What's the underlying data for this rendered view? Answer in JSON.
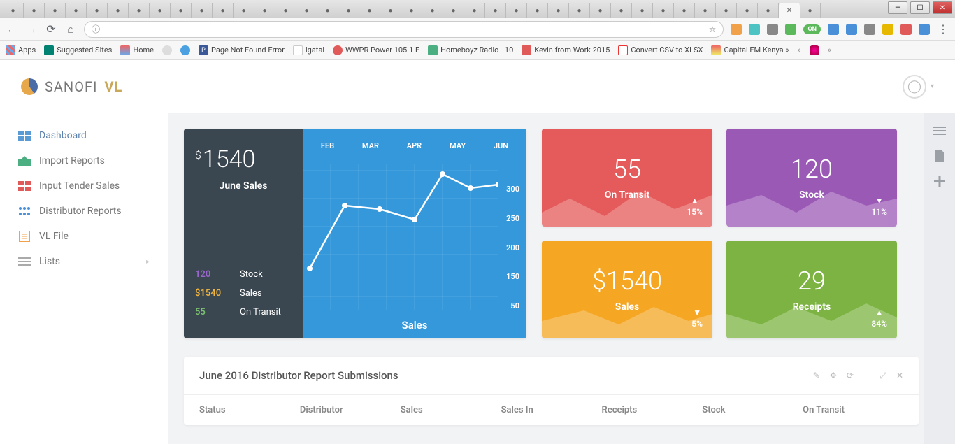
{
  "browser": {
    "window_controls": {
      "min": "—",
      "max": "☐",
      "close": "✕"
    },
    "nav": {
      "back": "←",
      "forward": "→",
      "reload": "⟳",
      "home": "⌂",
      "info": "ⓘ",
      "star": "☆"
    },
    "ext_toggle": "ON",
    "bookmarks": {
      "apps": "Apps",
      "suggested": "Suggested Sites",
      "home": "Home",
      "notfound": "Page Not Found Error",
      "igatal": "igatal",
      "wwpr": "WWPR Power 105.1 F",
      "homeboyz": "Homeboyz Radio - 10",
      "kevin": "Kevin from Work 2015",
      "convert": "Convert CSV to XLSX",
      "capital": "Capital FM Kenya »"
    }
  },
  "brand": {
    "text1": "SANOFI",
    "text2": "VL"
  },
  "sidebar": {
    "items": [
      {
        "label": "Dashboard",
        "color": "#5a9bd5"
      },
      {
        "label": "Import Reports",
        "color": "#4caf82"
      },
      {
        "label": "Input Tender Sales",
        "color": "#e05a5a"
      },
      {
        "label": "Distributor Reports",
        "color": "#4a90d9"
      },
      {
        "label": "VL File",
        "color": "#f0a14a"
      },
      {
        "label": "Lists",
        "color": "#aaa"
      }
    ]
  },
  "big_card": {
    "currency": "$",
    "amount": "1540",
    "subtitle": "June Sales",
    "chart_bottom": "Sales",
    "legend": [
      {
        "val": "120",
        "label": "Stock",
        "cls": "lg-stock"
      },
      {
        "val": "$1540",
        "label": "Sales",
        "cls": "lg-sales"
      },
      {
        "val": "55",
        "label": "On Transit",
        "cls": "lg-transit"
      }
    ]
  },
  "chart_data": {
    "type": "line",
    "categories": [
      "FEB",
      "MAR",
      "APR",
      "MAY",
      "JUN"
    ],
    "values": [
      200,
      250,
      245,
      230,
      300,
      280,
      285
    ],
    "ylim": [
      50,
      300
    ],
    "ytick": [
      "300",
      "250",
      "200",
      "150",
      "50"
    ],
    "xlabel": "",
    "ylabel": "",
    "title": "Sales"
  },
  "small_cards": [
    {
      "value": "55",
      "label": "On Transit",
      "pct": "15%",
      "arrow": "▲",
      "cls": "c-red"
    },
    {
      "value": "120",
      "label": "Stock",
      "pct": "11%",
      "arrow": "▼",
      "cls": "c-purple"
    },
    {
      "value": "$1540",
      "label": "Sales",
      "pct": "5%",
      "arrow": "▼",
      "cls": "c-yellow"
    },
    {
      "value": "29",
      "label": "Receipts",
      "pct": "84%",
      "arrow": "▲",
      "cls": "c-green"
    }
  ],
  "panel": {
    "title": "June 2016 Distributor Report Submissions",
    "columns": [
      "Status",
      "Distributor",
      "Sales",
      "Sales In",
      "Receipts",
      "Stock",
      "On Transit"
    ]
  }
}
